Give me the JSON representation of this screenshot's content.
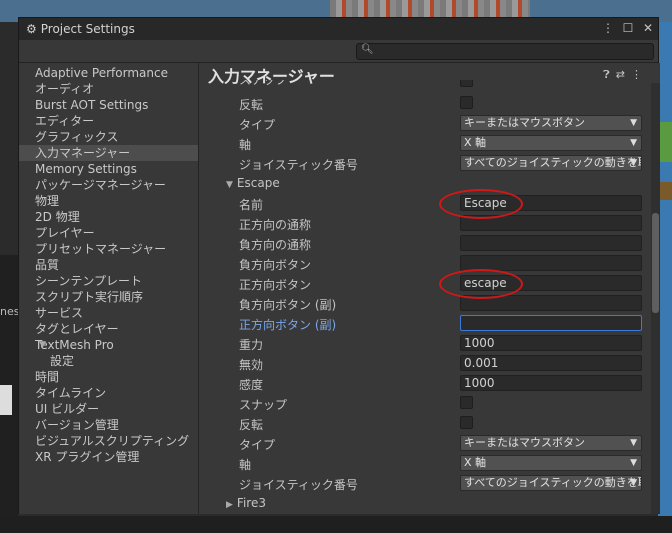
{
  "window": {
    "title": "Project Settings"
  },
  "search": {
    "placeholder": ""
  },
  "sidebar": {
    "items": [
      "Adaptive Performance",
      "オーディオ",
      "Burst AOT Settings",
      "エディター",
      "グラフィックス",
      "入力マネージャー",
      "Memory Settings",
      "パッケージマネージャー",
      "物理",
      "2D 物理",
      "プレイヤー",
      "プリセットマネージャー",
      "品質",
      "シーンテンプレート",
      "スクリプト実行順序",
      "サービス",
      "タグとレイヤー",
      "TextMesh Pro",
      "設定",
      "時間",
      "タイムライン",
      "UI ビルダー",
      "バージョン管理",
      "ビジュアルスクリプティング",
      "XR プラグイン管理"
    ],
    "selected": "入力マネージャー"
  },
  "main": {
    "title": "入力マネージャー",
    "rows": {
      "r_snap_top": "スナップ",
      "r_invert1": "反転",
      "r_type1": "タイプ",
      "r_type1_val": "キーまたはマウスボタン",
      "r_axis1": "軸",
      "r_axis1_val": "X 軸",
      "r_joy1": "ジョイスティック番号",
      "r_joy1_val": "すべてのジョイスティックの動きを取得",
      "escape": "Escape",
      "name": "名前",
      "name_val": "Escape",
      "posname": "正方向の通称",
      "negname": "負方向の通称",
      "negbtn": "負方向ボタン",
      "posbtn": "正方向ボタン",
      "posbtn_val": "escape",
      "negbtn2": "負方向ボタン (副)",
      "posbtn2": "正方向ボタン (副)",
      "gravity": "重力",
      "gravity_val": "1000",
      "dead": "無効",
      "dead_val": "0.001",
      "sens": "感度",
      "sens_val": "1000",
      "snap": "スナップ",
      "invert": "反転",
      "type": "タイプ",
      "type_val": "キーまたはマウスボタン",
      "axis": "軸",
      "axis_val": "X 軸",
      "joy": "ジョイスティック番号",
      "joy_val": "すべてのジョイスティックの動きを取得",
      "fire3": "Fire3"
    }
  },
  "background": {
    "left_label": "nes"
  },
  "colors": {
    "accent": "#3b7ad8",
    "annotation": "#d01818"
  }
}
